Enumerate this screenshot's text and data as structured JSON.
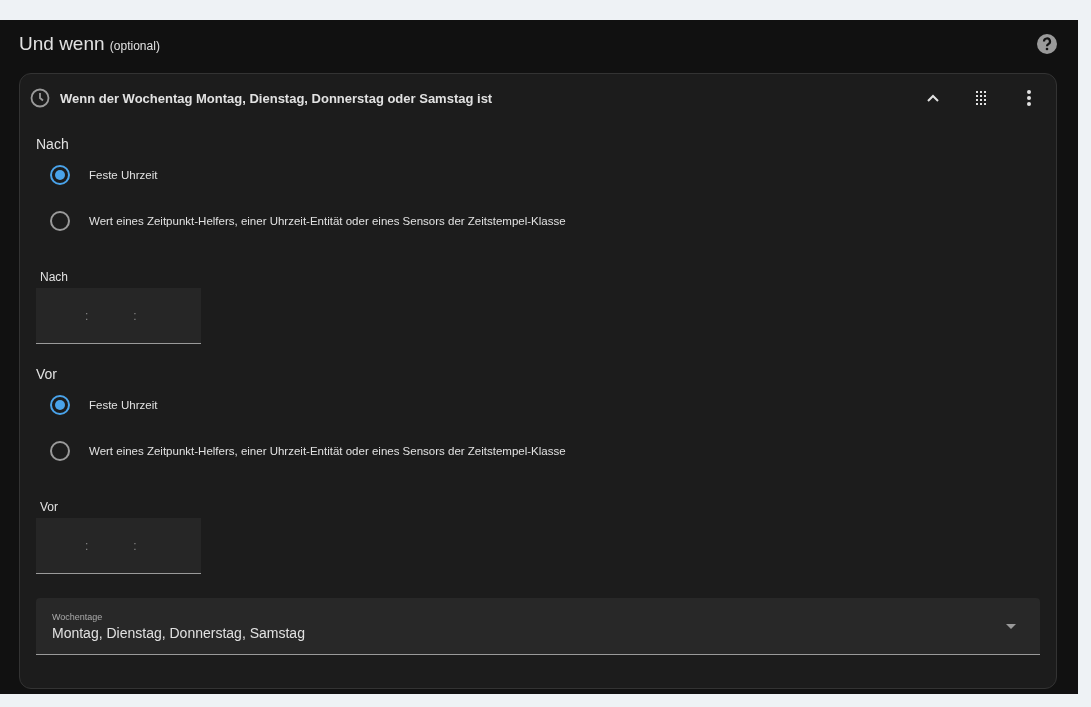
{
  "section": {
    "title": "Und wenn",
    "title_note": "(optional)"
  },
  "condition": {
    "title": "Wenn der Wochentag Montag, Dienstag, Donnerstag oder Samstag ist",
    "expanded": true,
    "groups": [
      {
        "heading": "Nach",
        "options": [
          {
            "label": "Feste Uhrzeit",
            "selected": true
          },
          {
            "label": "Wert eines Zeitpunkt-Helfers, einer Uhrzeit-Entität oder eines Sensors der Zeitstempel-Klasse",
            "selected": false
          }
        ],
        "time_label": "Nach",
        "separators": [
          ":",
          ":"
        ]
      },
      {
        "heading": "Vor",
        "options": [
          {
            "label": "Feste Uhrzeit",
            "selected": true
          },
          {
            "label": "Wert eines Zeitpunkt-Helfers, einer Uhrzeit-Entität oder eines Sensors der Zeitstempel-Klasse",
            "selected": false
          }
        ],
        "time_label": "Vor",
        "separators": [
          ":",
          ":"
        ]
      }
    ],
    "weekdays": {
      "label": "Wochentage",
      "value": "Montag, Dienstag, Donnerstag, Samstag"
    }
  }
}
